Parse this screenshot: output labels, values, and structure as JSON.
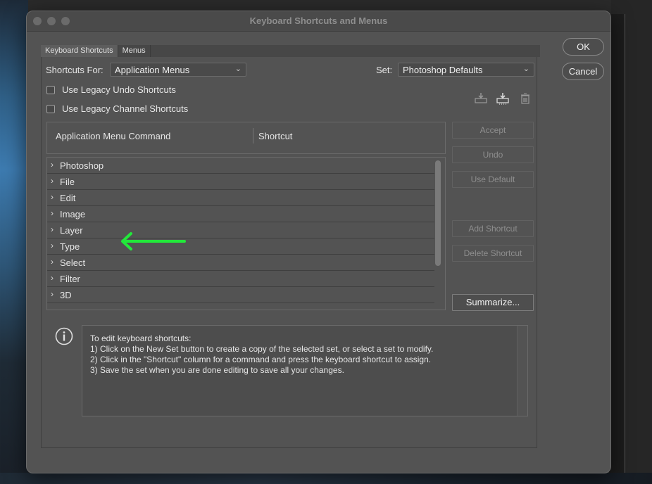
{
  "dialog": {
    "title": "Keyboard Shortcuts and Menus",
    "ok_label": "OK",
    "cancel_label": "Cancel"
  },
  "tabs": [
    {
      "label": "Keyboard Shortcuts",
      "active": true
    },
    {
      "label": "Menus",
      "active": false
    }
  ],
  "shortcuts_for": {
    "label": "Shortcuts For:",
    "value": "Application Menus"
  },
  "set": {
    "label": "Set:",
    "value": "Photoshop Defaults"
  },
  "options": {
    "legacy_undo": {
      "label": "Use Legacy Undo Shortcuts",
      "checked": false
    },
    "legacy_channel": {
      "label": "Use Legacy Channel Shortcuts",
      "checked": false
    }
  },
  "set_tools": [
    "save-set-icon",
    "new-set-icon",
    "delete-set-icon"
  ],
  "table": {
    "col_command": "Application Menu Command",
    "col_shortcut": "Shortcut",
    "rows": [
      "Photoshop",
      "File",
      "Edit",
      "Image",
      "Layer",
      "Type",
      "Select",
      "Filter",
      "3D"
    ]
  },
  "buttons": {
    "accept": "Accept",
    "undo": "Undo",
    "use_default": "Use Default",
    "add_shortcut": "Add Shortcut",
    "delete_shortcut": "Delete Shortcut",
    "summarize": "Summarize..."
  },
  "info": {
    "lines": [
      "To edit keyboard shortcuts:",
      "1) Click on the New Set button to create a copy of the selected set, or select a set to modify.",
      "2) Click in the \"Shortcut\" column for a command and press the keyboard shortcut to assign.",
      "3) Save the set when you are done editing to save all your changes."
    ]
  },
  "colors": {
    "dialog_bg": "#535353",
    "annotation_arrow": "#22e83a"
  }
}
